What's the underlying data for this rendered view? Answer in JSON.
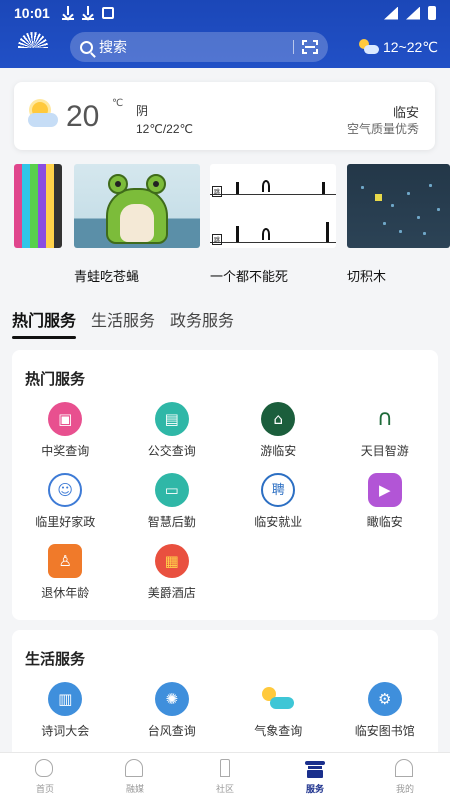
{
  "status_bar": {
    "time": "10:01"
  },
  "header": {
    "search_placeholder": "搜索",
    "weather_temp_range": "12~22℃"
  },
  "weather_card": {
    "temperature": "20",
    "unit": "℃",
    "condition": "阴",
    "range": "12℃/22℃",
    "city": "临安",
    "air_quality": "空气质量优秀"
  },
  "games": [
    {
      "label": ""
    },
    {
      "label": "青蛙吃苍蝇"
    },
    {
      "label": "一个都不能死"
    },
    {
      "label": "切积木"
    }
  ],
  "tabs": [
    {
      "label": "热门服务",
      "active": true
    },
    {
      "label": "生活服务",
      "active": false
    },
    {
      "label": "政务服务",
      "active": false
    }
  ],
  "hot_services": {
    "title": "热门服务",
    "items": [
      {
        "label": "中奖查询",
        "icon": "gift-icon",
        "color": "#e8508f"
      },
      {
        "label": "公交查询",
        "icon": "bus-icon",
        "color": "#2fb7a7"
      },
      {
        "label": "游临安",
        "icon": "tour-icon",
        "color": "#1b5e3c"
      },
      {
        "label": "天目智游",
        "icon": "mountain-icon",
        "color": "#ffffff"
      },
      {
        "label": "临里好家政",
        "icon": "housekeeping-icon",
        "color": "#3e7bd6"
      },
      {
        "label": "智慧后勤",
        "icon": "wallet-icon",
        "color": "#2fb7a7"
      },
      {
        "label": "临安就业",
        "icon": "employment-icon",
        "color": "#2c6fc3"
      },
      {
        "label": "瞰临安",
        "icon": "video-icon",
        "color": "#b255d6"
      },
      {
        "label": "退休年龄",
        "icon": "walking-icon",
        "color": "#f07a2a"
      },
      {
        "label": "美爵酒店",
        "icon": "hotel-icon",
        "color": "#e9503f"
      }
    ]
  },
  "life_services": {
    "title": "生活服务",
    "items": [
      {
        "label": "诗词大会",
        "icon": "book-icon",
        "color": "#3f8fdc"
      },
      {
        "label": "台风查询",
        "icon": "atom-icon",
        "color": "#3f8fdc"
      },
      {
        "label": "气象查询",
        "icon": "weather-icon",
        "color": "#3ec6d6"
      },
      {
        "label": "临安图书馆",
        "icon": "gear-icon",
        "color": "#3f8fdc"
      }
    ]
  },
  "tabbar": [
    {
      "label": "首页",
      "active": false
    },
    {
      "label": "融媒",
      "active": false
    },
    {
      "label": "社区",
      "active": false
    },
    {
      "label": "服务",
      "active": true
    },
    {
      "label": "我的",
      "active": false
    }
  ]
}
